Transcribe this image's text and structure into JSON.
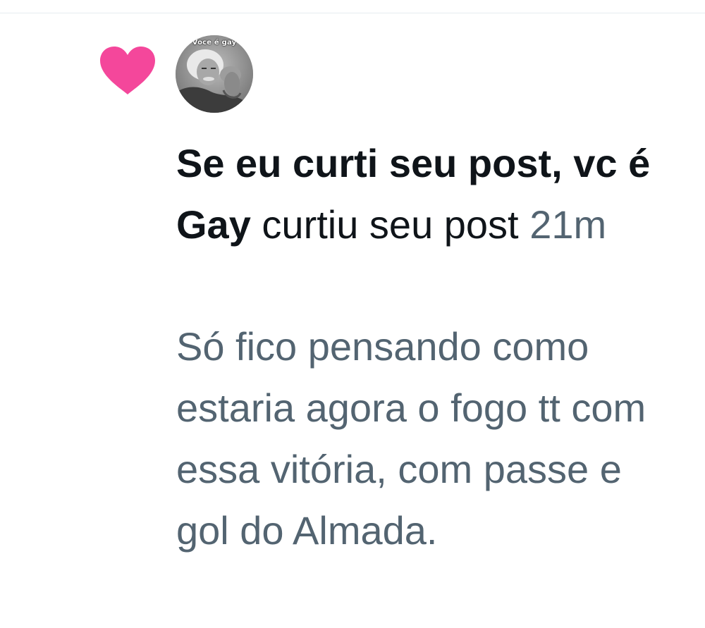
{
  "notification": {
    "icon": "heart-icon",
    "icon_color": "#f4479b",
    "avatar_caption": "Voce é gay",
    "user_name": "Se eu curti seu post, vc é Gay",
    "action": "curtiu seu post",
    "time": "21m",
    "post_text": "Só fico pensando como estaria agora o fogo tt com essa vitória, com passe e gol do Almada."
  },
  "colors": {
    "primary_text": "#0f1419",
    "secondary_text": "#536471",
    "like_pink": "#f4479b"
  }
}
